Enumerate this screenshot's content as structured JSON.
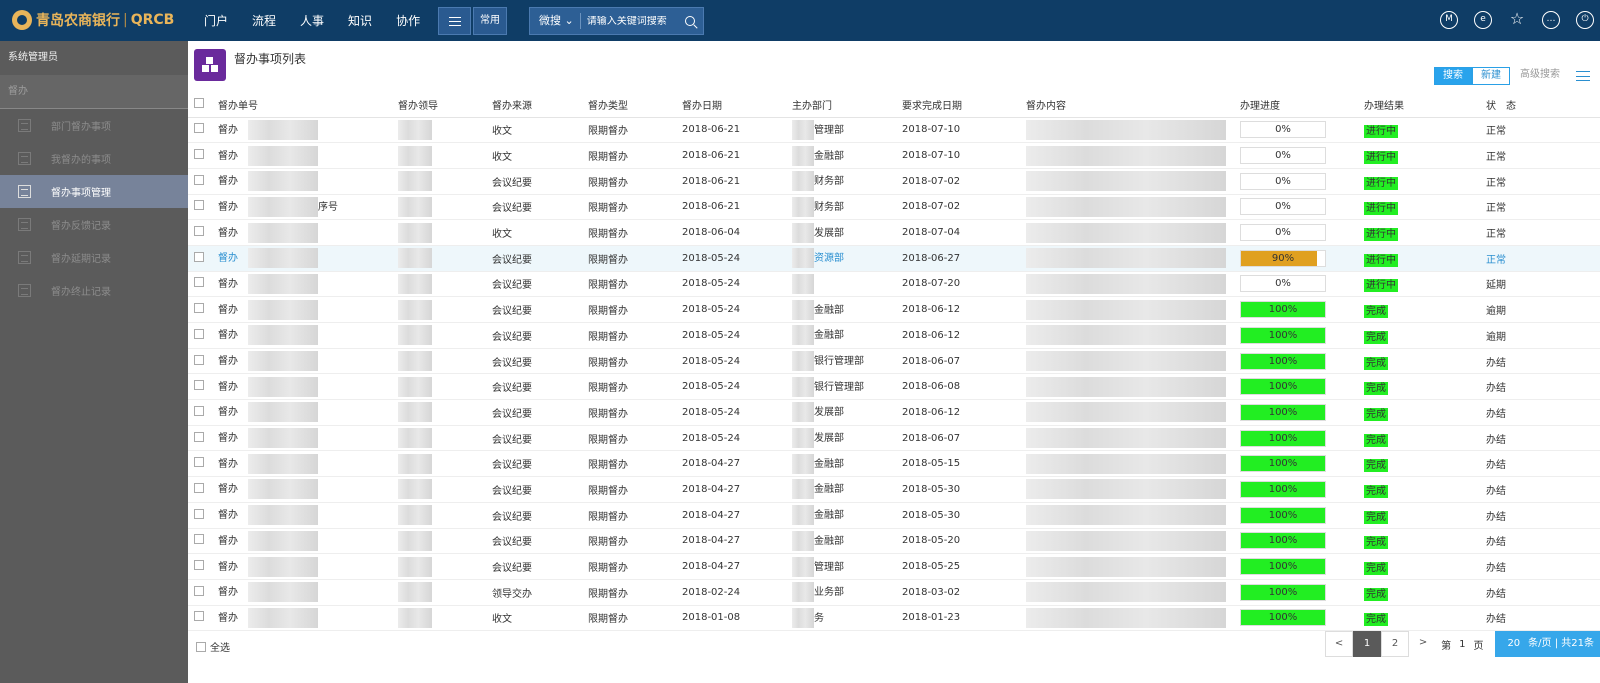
{
  "brand": {
    "name": "青岛农商银行",
    "sep": "|",
    "abbr": "QRCB"
  },
  "nav": [
    {
      "label": "门户"
    },
    {
      "label": "流程"
    },
    {
      "label": "人事"
    },
    {
      "label": "知识"
    },
    {
      "label": "协作"
    }
  ],
  "common_label": "常用",
  "search": {
    "scope": "微搜",
    "placeholder": "请输入关键词搜索"
  },
  "top_icons": [
    {
      "name": "m-icon",
      "glyph": "M"
    },
    {
      "name": "e-icon",
      "glyph": "e"
    },
    {
      "name": "star-icon",
      "glyph": "☆"
    },
    {
      "name": "more-icon",
      "glyph": "…"
    },
    {
      "name": "power-icon",
      "glyph": "⏻"
    }
  ],
  "sidebar": {
    "user": "系统管理员",
    "group": "督办",
    "items": [
      {
        "label": "部门督办事项"
      },
      {
        "label": "我督办的事项"
      },
      {
        "label": "督办事项管理"
      },
      {
        "label": "督办反馈记录"
      },
      {
        "label": "督办延期记录"
      },
      {
        "label": "督办终止记录"
      }
    ]
  },
  "page": {
    "title": "督办事项列表",
    "btn_search": "搜索",
    "btn_new": "新建",
    "btn_adv": "高级搜索"
  },
  "colors": {
    "topbar": "#0f3d66",
    "sidebar": "#5b5b5b",
    "active_item": "#77839a",
    "progress_green": "#22ee22",
    "progress_orange": "#e0a020",
    "result_green": "#22ee22",
    "accent": "#29a3ec"
  },
  "columns": [
    "督办单号",
    "督办领导",
    "督办来源",
    "督办类型",
    "督办日期",
    "主办部门",
    "要求完成日期",
    "督办内容",
    "办理进度",
    "办理结果",
    "状　态"
  ],
  "rows": [
    {
      "no": "督办",
      "src": "收文",
      "type": "限期督办",
      "date": "2018-06-21",
      "dept": "管理部",
      "due": "2018-07-10",
      "progress": 0,
      "ptxt": "0%",
      "result": "进行中",
      "status": "正常"
    },
    {
      "no": "督办",
      "src": "收文",
      "type": "限期督办",
      "date": "2018-06-21",
      "dept": "金融部",
      "due": "2018-07-10",
      "progress": 0,
      "ptxt": "0%",
      "result": "进行中",
      "status": "正常"
    },
    {
      "no": "督办",
      "src": "会议纪要",
      "type": "限期督办",
      "date": "2018-06-21",
      "dept": "财务部",
      "due": "2018-07-02",
      "progress": 0,
      "ptxt": "0%",
      "result": "进行中",
      "status": "正常"
    },
    {
      "no": "督办",
      "src": "会议纪要",
      "type": "限期督办",
      "date": "2018-06-21",
      "dept": "财务部",
      "due": "2018-07-02",
      "progress": 0,
      "ptxt": "0%",
      "result": "进行中",
      "status": "正常"
    },
    {
      "no": "督办",
      "src": "收文",
      "type": "限期督办",
      "date": "2018-06-04",
      "dept": "发展部",
      "due": "2018-07-04",
      "progress": 0,
      "ptxt": "0%",
      "result": "进行中",
      "status": "正常"
    },
    {
      "no": "督办",
      "src": "会议纪要",
      "type": "限期督办",
      "date": "2018-05-24",
      "dept": "资源部",
      "due": "2018-06-27",
      "progress": 90,
      "ptxt": "90%",
      "result": "进行中",
      "status": "正常"
    },
    {
      "no": "督办",
      "src": "会议纪要",
      "type": "限期督办",
      "date": "2018-05-24",
      "dept": "",
      "due": "2018-07-20",
      "progress": 0,
      "ptxt": "0%",
      "result": "进行中",
      "status": "延期"
    },
    {
      "no": "督办",
      "src": "会议纪要",
      "type": "限期督办",
      "date": "2018-05-24",
      "dept": "金融部",
      "due": "2018-06-12",
      "progress": 100,
      "ptxt": "100%",
      "result": "完成",
      "status": "逾期"
    },
    {
      "no": "督办",
      "src": "会议纪要",
      "type": "限期督办",
      "date": "2018-05-24",
      "dept": "金融部",
      "due": "2018-06-12",
      "progress": 100,
      "ptxt": "100%",
      "result": "完成",
      "status": "逾期"
    },
    {
      "no": "督办",
      "src": "会议纪要",
      "type": "限期督办",
      "date": "2018-05-24",
      "dept": "银行管理部",
      "due": "2018-06-07",
      "progress": 100,
      "ptxt": "100%",
      "result": "完成",
      "status": "办结"
    },
    {
      "no": "督办",
      "src": "会议纪要",
      "type": "限期督办",
      "date": "2018-05-24",
      "dept": "银行管理部",
      "due": "2018-06-08",
      "progress": 100,
      "ptxt": "100%",
      "result": "完成",
      "status": "办结"
    },
    {
      "no": "督办",
      "src": "会议纪要",
      "type": "限期督办",
      "date": "2018-05-24",
      "dept": "发展部",
      "due": "2018-06-12",
      "progress": 100,
      "ptxt": "100%",
      "result": "完成",
      "status": "办结"
    },
    {
      "no": "督办",
      "src": "会议纪要",
      "type": "限期督办",
      "date": "2018-05-24",
      "dept": "发展部",
      "due": "2018-06-07",
      "progress": 100,
      "ptxt": "100%",
      "result": "完成",
      "status": "办结"
    },
    {
      "no": "督办",
      "src": "会议纪要",
      "type": "限期督办",
      "date": "2018-04-27",
      "dept": "金融部",
      "due": "2018-05-15",
      "progress": 100,
      "ptxt": "100%",
      "result": "完成",
      "status": "办结"
    },
    {
      "no": "督办",
      "src": "会议纪要",
      "type": "限期督办",
      "date": "2018-04-27",
      "dept": "金融部",
      "due": "2018-05-30",
      "progress": 100,
      "ptxt": "100%",
      "result": "完成",
      "status": "办结"
    },
    {
      "no": "督办",
      "src": "会议纪要",
      "type": "限期督办",
      "date": "2018-04-27",
      "dept": "金融部",
      "due": "2018-05-30",
      "progress": 100,
      "ptxt": "100%",
      "result": "完成",
      "status": "办结"
    },
    {
      "no": "督办",
      "src": "会议纪要",
      "type": "限期督办",
      "date": "2018-04-27",
      "dept": "金融部",
      "due": "2018-05-20",
      "progress": 100,
      "ptxt": "100%",
      "result": "完成",
      "status": "办结"
    },
    {
      "no": "督办",
      "src": "会议纪要",
      "type": "限期督办",
      "date": "2018-04-27",
      "dept": "管理部",
      "due": "2018-05-25",
      "progress": 100,
      "ptxt": "100%",
      "result": "完成",
      "status": "办结"
    },
    {
      "no": "督办",
      "src": "领导交办",
      "type": "限期督办",
      "date": "2018-02-24",
      "dept": "业务部",
      "due": "2018-03-02",
      "progress": 100,
      "ptxt": "100%",
      "result": "完成",
      "status": "办结"
    },
    {
      "no": "督办",
      "src": "收文",
      "type": "限期督办",
      "date": "2018-01-08",
      "dept": "务",
      "due": "2018-01-23",
      "progress": 100,
      "ptxt": "100%",
      "result": "完成",
      "status": "办结"
    }
  ],
  "extra_fragment": "序号",
  "footer": {
    "select_all": "全选",
    "prev": "<",
    "pages": [
      "1",
      "2"
    ],
    "next": ">",
    "goto_prefix": "第",
    "goto_page": "1",
    "goto_suffix": "页",
    "page_size": "20",
    "size_suffix": "条/页 | 共21条"
  }
}
